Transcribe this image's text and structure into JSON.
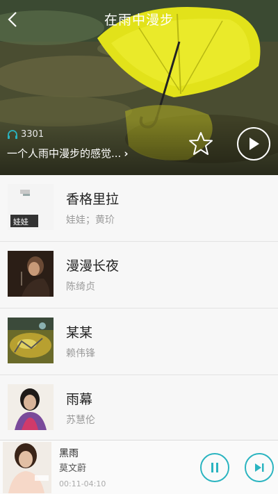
{
  "header": {
    "title": "在雨中漫步",
    "listen_count": "3301",
    "description": "一个人雨中漫步的感觉...",
    "description_arrow": "›"
  },
  "songs": [
    {
      "title": "香格里拉",
      "artist": "娃娃；黄玠",
      "cover_text": "娃娃"
    },
    {
      "title": "漫漫长夜",
      "artist": "陈绮贞"
    },
    {
      "title": "某某",
      "artist": "赖伟锋"
    },
    {
      "title": "雨幕",
      "artist": "苏慧伦"
    }
  ],
  "now_playing": {
    "title": "黑雨",
    "artist": "莫文蔚",
    "time": "00:11-04:10"
  },
  "colors": {
    "accent": "#2ab4c0",
    "umbrella": "#e6e61a"
  },
  "icons": {
    "back": "chevron-left-icon",
    "headphones": "headphones-icon",
    "favorite": "star-outline-icon",
    "play": "play-icon",
    "pause": "pause-icon",
    "next": "skip-next-icon"
  }
}
